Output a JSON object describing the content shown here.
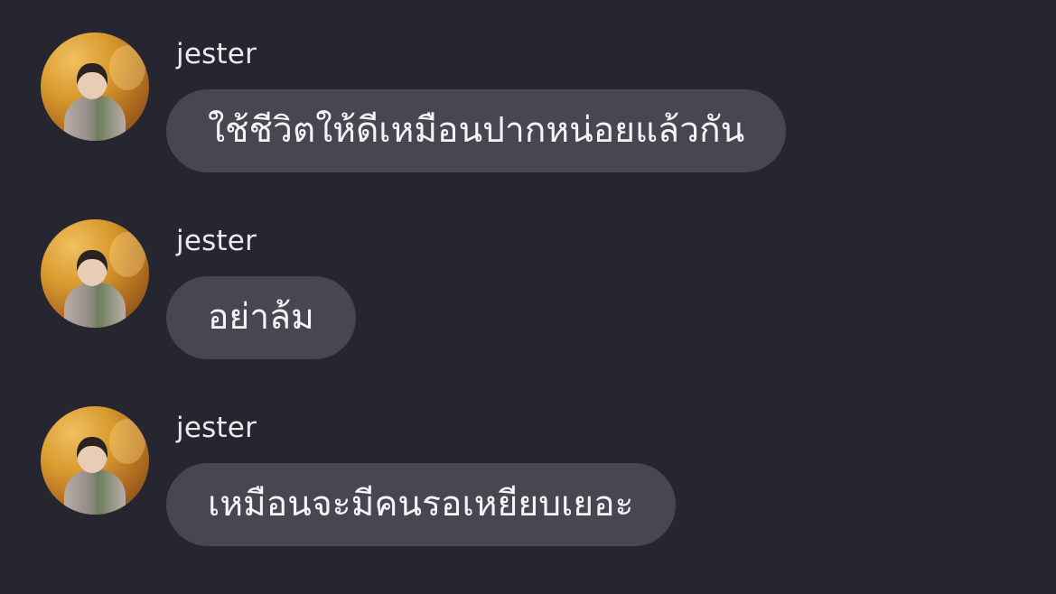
{
  "messages": [
    {
      "username": "jester",
      "avatar": "user-avatar",
      "text": "ใช้ชีวิตให้ดีเหมือนปากหน่อยแล้วกัน"
    },
    {
      "username": "jester",
      "avatar": "user-avatar",
      "text": "อย่าล้ม"
    },
    {
      "username": "jester",
      "avatar": "user-avatar",
      "text": "เหมือนจะมีคนรอเหยียบเยอะ"
    }
  ],
  "colors": {
    "background": "#262630",
    "bubble": "#474751",
    "text": "#f4f4f7",
    "username": "#e9e9ee"
  }
}
